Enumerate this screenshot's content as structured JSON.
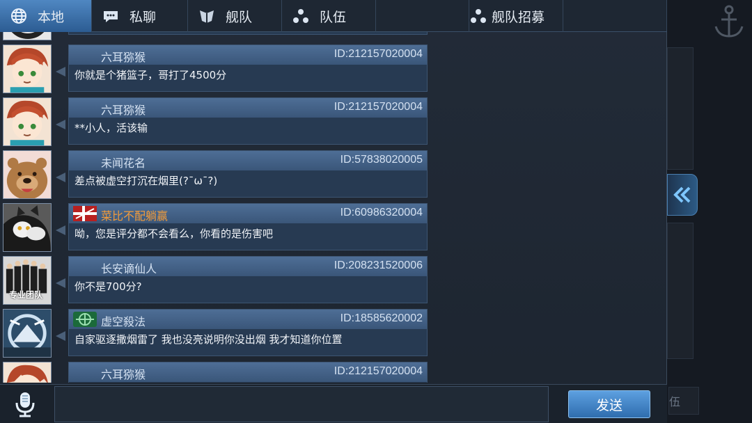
{
  "tabs": [
    {
      "label": "本地",
      "icon": "globe-icon",
      "active": true
    },
    {
      "label": "私聊",
      "icon": "chat-bubble-icon",
      "active": false
    },
    {
      "label": "舰队",
      "icon": "fleet-emblem-icon",
      "active": false
    },
    {
      "label": "队伍",
      "icon": "team-dots-icon",
      "active": false
    },
    {
      "label": "舰队招募",
      "icon": "recruit-dots-icon",
      "active": false
    }
  ],
  "messages": [
    {
      "name": "六耳猕猴",
      "id": "ID:212157020004",
      "text": "你就是个猪篮子，哥打了4500分"
    },
    {
      "name": "六耳猕猴",
      "id": "ID:212157020004",
      "text": "**小人，活该输"
    },
    {
      "name": "未闻花名",
      "id": "ID:57838020005",
      "text": "差点被虚空打沉在烟里(?¯ω¯?)"
    },
    {
      "name": "菜比不配躺赢",
      "id": "ID:60986320004",
      "text": "呦，您是评分都不会看么，你看的是伤害吧"
    },
    {
      "name": "长安谪仙人",
      "id": "ID:208231520006",
      "text": "你不是700分?"
    },
    {
      "name": "虚空殺法",
      "id": "ID:18585620002",
      "text": "自家驱逐撒烟雷了 我也没亮说明你没出烟 我才知道你位置"
    },
    {
      "name": "六耳猕猴",
      "id": "ID:212157020004",
      "text": ""
    }
  ],
  "avatar_captions": {
    "team": "专业团队"
  },
  "send_label": "发送",
  "right_ghost_label": "伍",
  "colors": {
    "accent": "#4f87c2",
    "orange_name": "#f39c3a",
    "bubble": "#273a52"
  }
}
